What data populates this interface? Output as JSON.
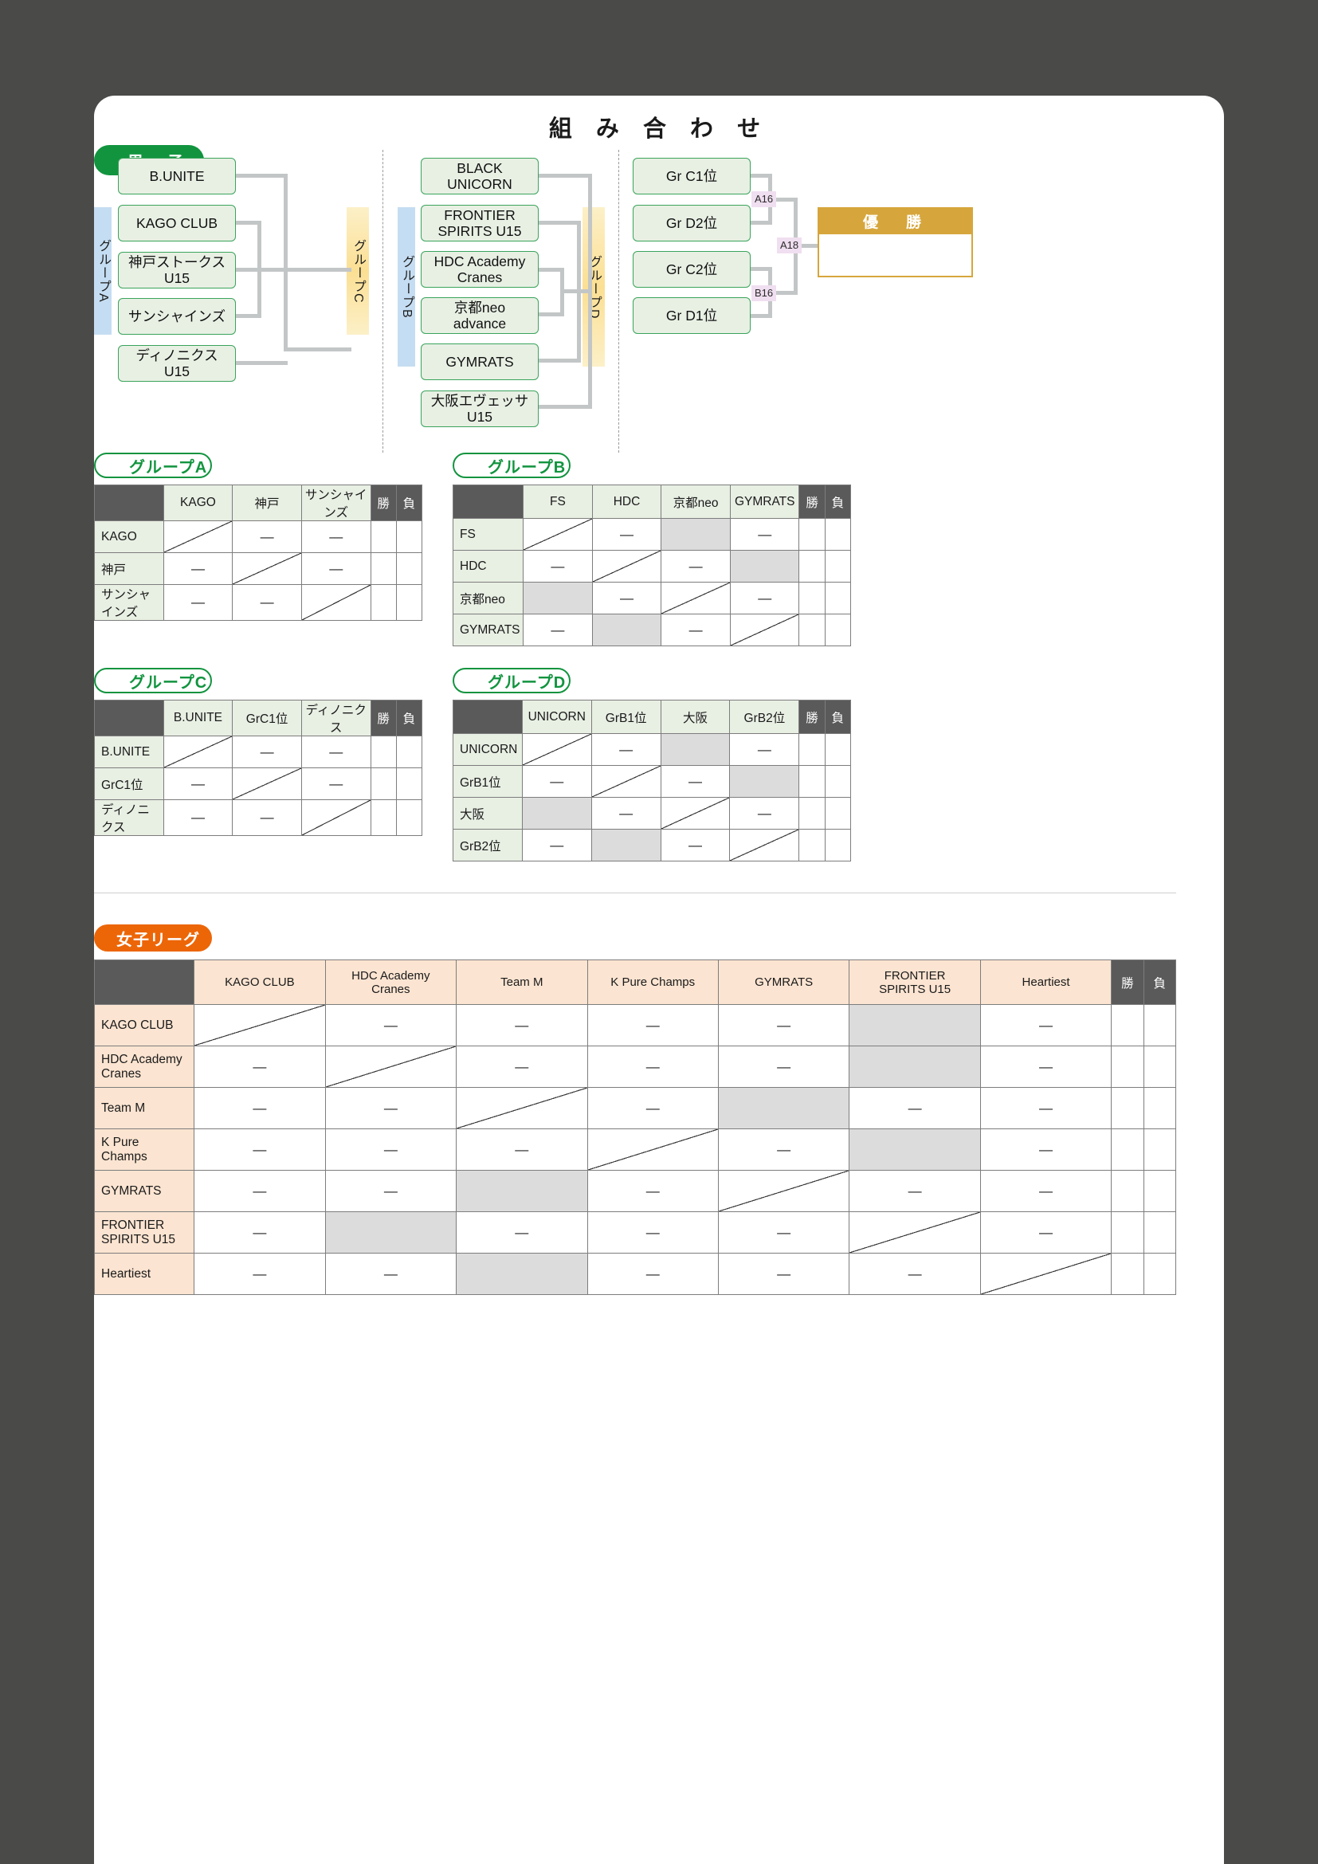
{
  "header": {
    "title": "組 み 合 わ せ"
  },
  "sections": {
    "mens_label": "男　子",
    "womens_label": "女子リーグ",
    "group_a_label": "グループA",
    "group_b_label": "グループB",
    "group_c_label": "グループC",
    "group_d_label": "グループD"
  },
  "bracket": {
    "group_a_tag": "グループA",
    "group_b_tag": "グループB",
    "group_c_tag": "グループC",
    "group_d_tag": "グループD",
    "left_teams": [
      "B.UNITE",
      "KAGO CLUB",
      "神戸ストークス\nU15",
      "サンシャインズ",
      "ディノニクス\nU15"
    ],
    "mid_teams": [
      "BLACK\nUNICORN",
      "FRONTIER\nSPIRITS U15",
      "HDC Academy\nCranes",
      "京都neo\nadvance",
      "GYMRATS",
      "大阪エヴェッサ\nU15"
    ],
    "final_slots": [
      "Gr C1位",
      "Gr D2位",
      "Gr C2位",
      "Gr D1位"
    ],
    "match_tags": [
      "A16",
      "A18",
      "B16"
    ],
    "champion_label": "優　勝"
  },
  "tables": {
    "win_header": "勝",
    "loss_header": "負",
    "dash": "—",
    "group_a": {
      "columns": [
        "KAGO",
        "神戸",
        "サンシャインズ"
      ],
      "rows": [
        {
          "name": "KAGO",
          "cells": [
            "diag",
            "—",
            "—"
          ]
        },
        {
          "name": "神戸",
          "cells": [
            "—",
            "diag",
            "—"
          ]
        },
        {
          "name": "サンシャインズ",
          "cells": [
            "—",
            "—",
            "diag"
          ]
        }
      ]
    },
    "group_b": {
      "columns": [
        "FS",
        "HDC",
        "京都neo",
        "GYMRATS"
      ],
      "rows": [
        {
          "name": "FS",
          "cells": [
            "diag",
            "—",
            "blk",
            "—"
          ]
        },
        {
          "name": "HDC",
          "cells": [
            "—",
            "diag",
            "—",
            "blk"
          ]
        },
        {
          "name": "京都neo",
          "cells": [
            "blk",
            "—",
            "diag",
            "—"
          ]
        },
        {
          "name": "GYMRATS",
          "cells": [
            "—",
            "blk",
            "—",
            "diag"
          ]
        }
      ]
    },
    "group_c": {
      "columns": [
        "B.UNITE",
        "GrC1位",
        "ディノニクス"
      ],
      "rows": [
        {
          "name": "B.UNITE",
          "cells": [
            "diag",
            "—",
            "—"
          ]
        },
        {
          "name": "GrC1位",
          "cells": [
            "—",
            "diag",
            "—"
          ]
        },
        {
          "name": "ディノニクス",
          "cells": [
            "—",
            "—",
            "diag"
          ]
        }
      ]
    },
    "group_d": {
      "columns": [
        "UNICORN",
        "GrB1位",
        "大阪",
        "GrB2位"
      ],
      "rows": [
        {
          "name": "UNICORN",
          "cells": [
            "diag",
            "—",
            "blk",
            "—"
          ]
        },
        {
          "name": "GrB1位",
          "cells": [
            "—",
            "diag",
            "—",
            "blk"
          ]
        },
        {
          "name": "大阪",
          "cells": [
            "blk",
            "—",
            "diag",
            "—"
          ]
        },
        {
          "name": "GrB2位",
          "cells": [
            "—",
            "blk",
            "—",
            "diag"
          ]
        }
      ]
    },
    "womens": {
      "columns": [
        "KAGO CLUB",
        "HDC Academy\nCranes",
        "Team M",
        "K Pure Champs",
        "GYMRATS",
        "FRONTIER\nSPIRITS U15",
        "Heartiest"
      ],
      "rows": [
        {
          "name": "KAGO CLUB",
          "cells": [
            "diag",
            "—",
            "—",
            "—",
            "—",
            "blk",
            "—"
          ]
        },
        {
          "name": "HDC Academy\nCranes",
          "cells": [
            "—",
            "diag",
            "—",
            "—",
            "—",
            "blk",
            "—"
          ]
        },
        {
          "name": "Team M",
          "cells": [
            "—",
            "—",
            "diag",
            "—",
            "blk",
            "—",
            "—"
          ]
        },
        {
          "name": "K Pure\nChamps",
          "cells": [
            "—",
            "—",
            "—",
            "diag",
            "—",
            "blk",
            "—"
          ]
        },
        {
          "name": "GYMRATS",
          "cells": [
            "—",
            "—",
            "blk",
            "—",
            "diag",
            "—",
            "—"
          ]
        },
        {
          "name": "FRONTIER\nSPIRITS U15",
          "cells": [
            "—",
            "blk",
            "—",
            "—",
            "—",
            "diag",
            "—"
          ]
        },
        {
          "name": "Heartiest",
          "cells": [
            "—",
            "—",
            "blk",
            "—",
            "—",
            "—",
            "diag"
          ]
        }
      ]
    }
  }
}
